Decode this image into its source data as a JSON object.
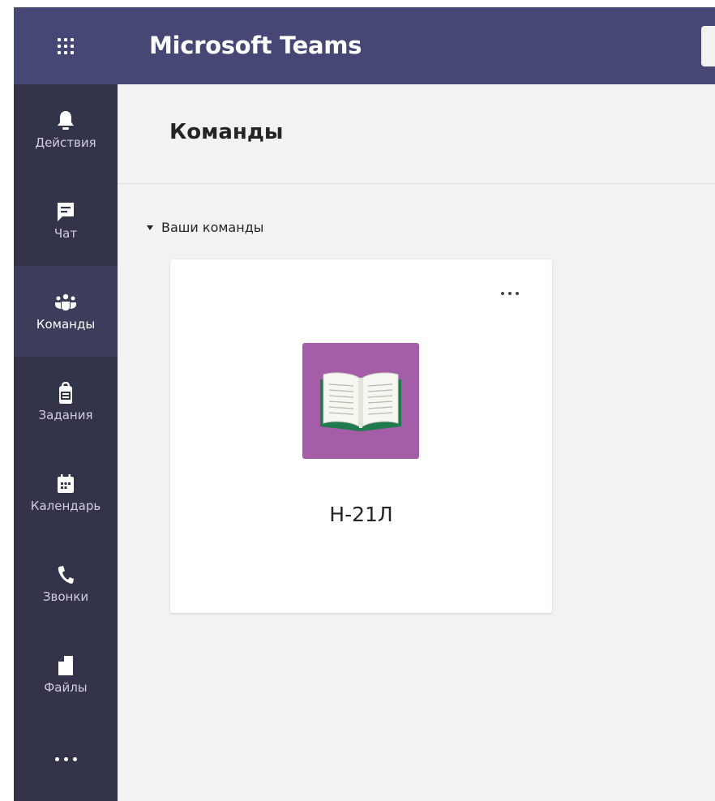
{
  "app": {
    "title": "Microsoft Teams",
    "colors": {
      "topbar": "#464775",
      "rail": "#33344a",
      "rail_active": "#3b3d5b",
      "background": "#f3f2f1",
      "team_avatar": "#a45da7"
    }
  },
  "rail": {
    "items": [
      {
        "label": "Действия",
        "icon": "bell-icon",
        "active": false
      },
      {
        "label": "Чат",
        "icon": "chat-icon",
        "active": false
      },
      {
        "label": "Команды",
        "icon": "teams-icon",
        "active": true
      },
      {
        "label": "Задания",
        "icon": "backpack-icon",
        "active": false
      },
      {
        "label": "Календарь",
        "icon": "calendar-icon",
        "active": false
      },
      {
        "label": "Звонки",
        "icon": "phone-icon",
        "active": false
      },
      {
        "label": "Файлы",
        "icon": "file-icon",
        "active": false
      }
    ],
    "more_icon": "more-icon"
  },
  "main": {
    "title": "Команды",
    "section": {
      "label": "Ваши команды",
      "expanded": true
    },
    "teams": [
      {
        "name": "Н-21Л",
        "icon": "book-icon"
      }
    ]
  }
}
